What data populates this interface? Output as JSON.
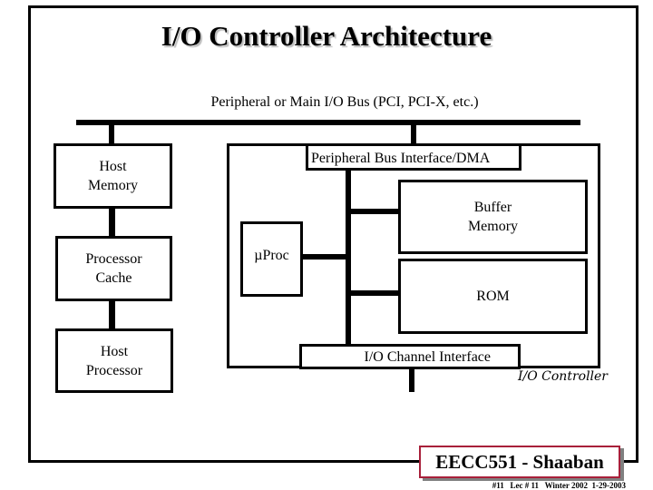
{
  "slide": {
    "title": "I/O Controller Architecture",
    "bus_label": "Peripheral or Main I/O Bus (PCI, PCI-X, etc.)"
  },
  "host_side": {
    "host_memory": [
      "Host",
      "Memory"
    ],
    "processor_cache": [
      "Processor",
      "Cache"
    ],
    "host_processor": [
      "Host",
      "Processor"
    ]
  },
  "controller": {
    "label": "I/O Controller",
    "peripheral_bus_interface": "Peripheral Bus Interface/DMA",
    "buffer_memory": [
      "Buffer",
      "Memory"
    ],
    "rom": "ROM",
    "microprocessor": "µProc",
    "io_channel_interface": "I/O Channel Interface"
  },
  "footer": {
    "badge": "EECC551 - Shaaban",
    "slide_info": "#11   Lec # 11   Winter 2002  1-29-2003",
    "badge_border_color": "#a8203a"
  }
}
